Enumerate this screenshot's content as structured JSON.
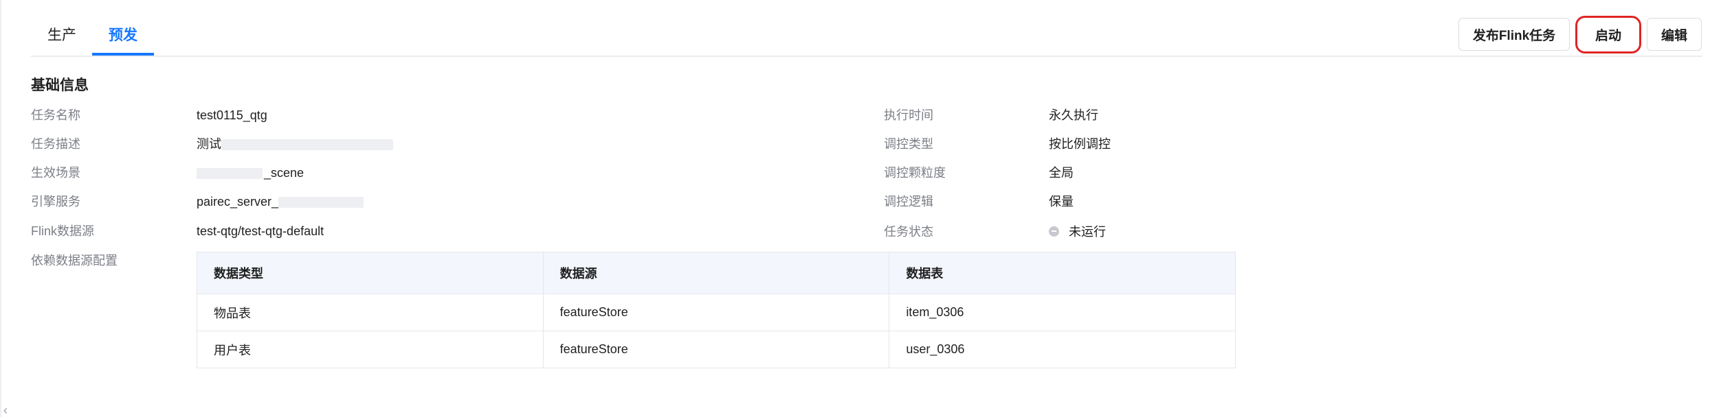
{
  "tabs": [
    {
      "label": "生产",
      "active": false
    },
    {
      "label": "预发",
      "active": true
    }
  ],
  "toolbar": {
    "publish_label": "发布Flink任务",
    "start_label": "启动",
    "edit_label": "编辑"
  },
  "section": {
    "title": "基础信息"
  },
  "info_left": [
    {
      "label": "任务名称",
      "value": "test0115_qtg"
    },
    {
      "label": "任务描述",
      "value": "测试"
    },
    {
      "label": "生效场景",
      "value": "_scene"
    },
    {
      "label": "引擎服务",
      "value": "pairec_server_"
    },
    {
      "label": "Flink数据源",
      "value": "test-qtg/test-qtg-default"
    },
    {
      "label": "依赖数据源配置",
      "value": ""
    }
  ],
  "info_right": [
    {
      "label": "执行时间",
      "value": "永久执行"
    },
    {
      "label": "调控类型",
      "value": "按比例调控"
    },
    {
      "label": "调控颗粒度",
      "value": "全局"
    },
    {
      "label": "调控逻辑",
      "value": "保量"
    },
    {
      "label": "任务状态",
      "value": "未运行"
    }
  ],
  "datasource_table": {
    "columns": [
      "数据类型",
      "数据源",
      "数据表"
    ],
    "rows": [
      [
        "物品表",
        "featureStore",
        "item_0306"
      ],
      [
        "用户表",
        "featureStore",
        "user_0306"
      ]
    ]
  },
  "colors": {
    "accent": "#1677ff",
    "highlight": "#e02424",
    "status_idle": "#c6c9ce"
  },
  "icons": {
    "status": "stopped-status-icon",
    "collapse": "chevron-left-icon"
  }
}
